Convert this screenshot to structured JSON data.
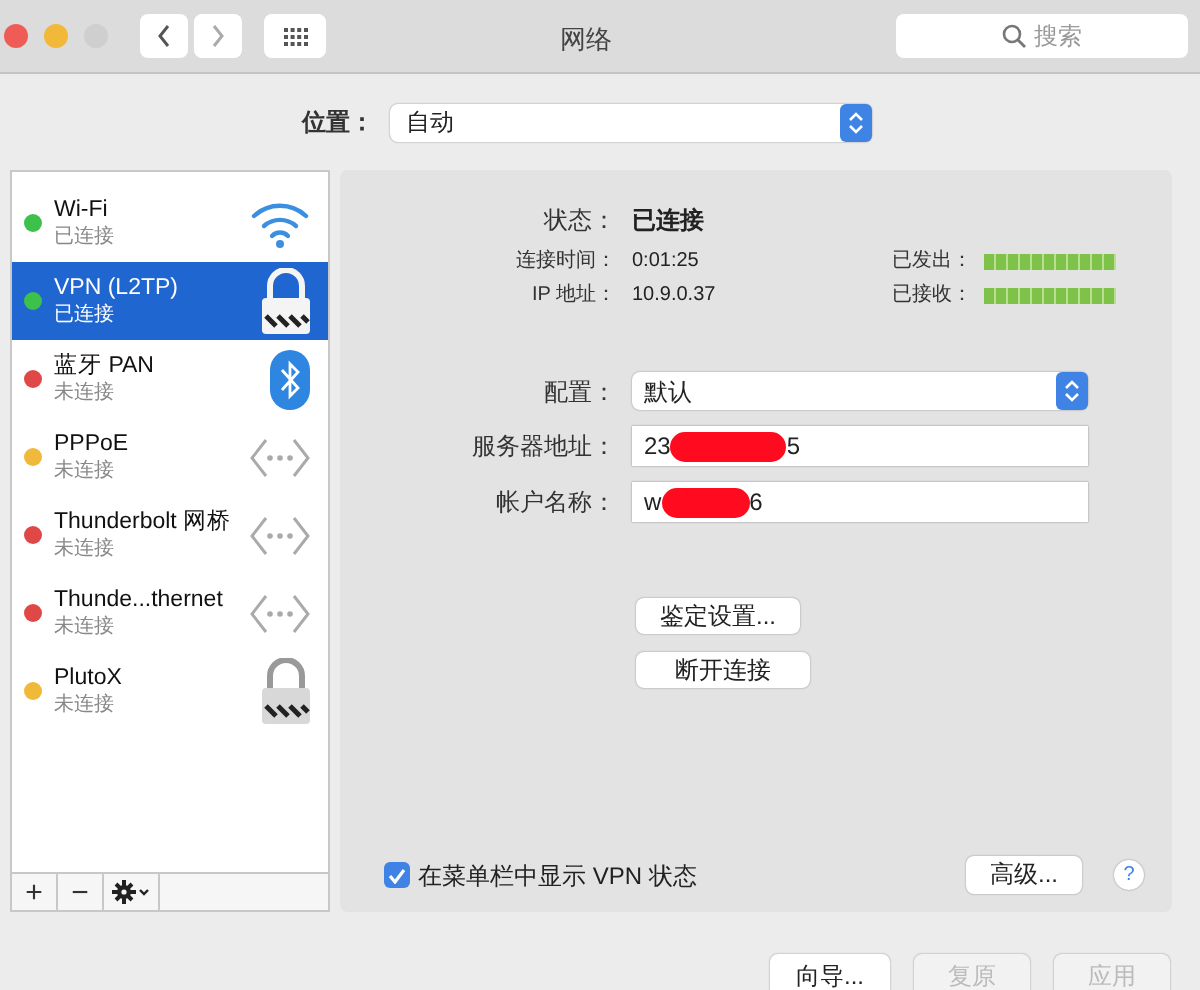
{
  "window": {
    "title": "网络",
    "search_placeholder": "搜索"
  },
  "location": {
    "label": "位置：",
    "value": "自动"
  },
  "services": [
    {
      "name": "Wi-Fi",
      "status": "已连接",
      "color": "#3cc24a",
      "kind": "wifi",
      "selected": false
    },
    {
      "name": "VPN (L2TP)",
      "status": "已连接",
      "color": "#3cc24a",
      "kind": "lock",
      "selected": true
    },
    {
      "name": "蓝牙 PAN",
      "status": "未连接",
      "color": "#e04848",
      "kind": "bluetooth",
      "selected": false
    },
    {
      "name": "PPPoE",
      "status": "未连接",
      "color": "#f0b93a",
      "kind": "ethernet",
      "selected": false
    },
    {
      "name": "Thunderbolt 网桥",
      "status": "未连接",
      "color": "#e04848",
      "kind": "ethernet",
      "selected": false
    },
    {
      "name": "Thunde...thernet",
      "status": "未连接",
      "color": "#e04848",
      "kind": "ethernet",
      "selected": false
    },
    {
      "name": "PlutoX",
      "status": "未连接",
      "color": "#f0b93a",
      "kind": "lock",
      "selected": false
    }
  ],
  "list_toolbar": [
    "+",
    "−"
  ],
  "detail": {
    "status_label": "状态：",
    "status_value": "已连接",
    "info": [
      {
        "label": "连接时间：",
        "value": "0:01:25",
        "meter_label": "已发出："
      },
      {
        "label": "IP 地址：",
        "value": "10.9.0.37",
        "meter_label": "已接收："
      }
    ],
    "config": {
      "label": "配置：",
      "value": "默认"
    },
    "fields": [
      {
        "label": "服务器地址：",
        "visible_start": "23",
        "visible_end": "5"
      },
      {
        "label": "帐户名称：",
        "visible_start": "w",
        "visible_end": "6"
      }
    ],
    "buttons": [
      "鉴定设置...",
      "断开连接"
    ],
    "show_in_menu_bar": {
      "label": "在菜单栏中显示 VPN 状态",
      "checked": true
    },
    "advanced_button": "高级...",
    "help": "?"
  },
  "footer_buttons": [
    {
      "label": "向导...",
      "disabled": false
    },
    {
      "label": "复原",
      "disabled": true
    },
    {
      "label": "应用",
      "disabled": true
    }
  ]
}
